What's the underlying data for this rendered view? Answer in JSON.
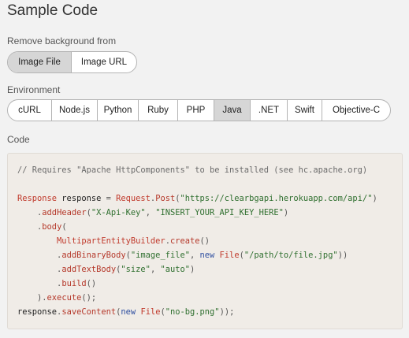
{
  "header": {
    "title": "Sample Code"
  },
  "remove_bg": {
    "label": "Remove background from",
    "options": [
      {
        "label": "Image File",
        "active": true
      },
      {
        "label": "Image URL",
        "active": false
      }
    ]
  },
  "environment": {
    "label": "Environment",
    "options": [
      {
        "label": "cURL",
        "active": false
      },
      {
        "label": "Node.js",
        "active": false
      },
      {
        "label": "Python",
        "active": false
      },
      {
        "label": "Ruby",
        "active": false
      },
      {
        "label": "PHP",
        "active": false
      },
      {
        "label": "Java",
        "active": true
      },
      {
        "label": ".NET",
        "active": false
      },
      {
        "label": "Swift",
        "active": false
      },
      {
        "label": "Objective-C",
        "active": false
      }
    ]
  },
  "code": {
    "label": "Code",
    "lines": [
      [
        {
          "t": "// Requires \"Apache HttpComponents\" to be installed (see hc.apache.org)",
          "c": "comment"
        }
      ],
      [],
      [
        {
          "t": "Response",
          "c": "type"
        },
        {
          "t": " response ",
          "c": "plain"
        },
        {
          "t": "=",
          "c": "punct"
        },
        {
          "t": " Request",
          "c": "type"
        },
        {
          "t": ".",
          "c": "punct"
        },
        {
          "t": "Post",
          "c": "method"
        },
        {
          "t": "(",
          "c": "punct"
        },
        {
          "t": "\"https://clearbgapi.herokuapp.com/api/\"",
          "c": "string"
        },
        {
          "t": ")",
          "c": "punct"
        }
      ],
      [
        {
          "t": "    ",
          "c": "plain"
        },
        {
          "t": ".",
          "c": "punct"
        },
        {
          "t": "addHeader",
          "c": "method"
        },
        {
          "t": "(",
          "c": "punct"
        },
        {
          "t": "\"X-Api-Key\"",
          "c": "string"
        },
        {
          "t": ", ",
          "c": "punct"
        },
        {
          "t": "\"INSERT_YOUR_API_KEY_HERE\"",
          "c": "string"
        },
        {
          "t": ")",
          "c": "punct"
        }
      ],
      [
        {
          "t": "    ",
          "c": "plain"
        },
        {
          "t": ".",
          "c": "punct"
        },
        {
          "t": "body",
          "c": "method"
        },
        {
          "t": "(",
          "c": "punct"
        }
      ],
      [
        {
          "t": "        ",
          "c": "plain"
        },
        {
          "t": "MultipartEntityBuilder",
          "c": "type"
        },
        {
          "t": ".",
          "c": "punct"
        },
        {
          "t": "create",
          "c": "method"
        },
        {
          "t": "()",
          "c": "punct"
        }
      ],
      [
        {
          "t": "        ",
          "c": "plain"
        },
        {
          "t": ".",
          "c": "punct"
        },
        {
          "t": "addBinaryBody",
          "c": "method"
        },
        {
          "t": "(",
          "c": "punct"
        },
        {
          "t": "\"image_file\"",
          "c": "string"
        },
        {
          "t": ", ",
          "c": "punct"
        },
        {
          "t": "new",
          "c": "kw"
        },
        {
          "t": " ",
          "c": "plain"
        },
        {
          "t": "File",
          "c": "type"
        },
        {
          "t": "(",
          "c": "punct"
        },
        {
          "t": "\"/path/to/file.jpg\"",
          "c": "string"
        },
        {
          "t": "))",
          "c": "punct"
        }
      ],
      [
        {
          "t": "        ",
          "c": "plain"
        },
        {
          "t": ".",
          "c": "punct"
        },
        {
          "t": "addTextBody",
          "c": "method"
        },
        {
          "t": "(",
          "c": "punct"
        },
        {
          "t": "\"size\"",
          "c": "string"
        },
        {
          "t": ", ",
          "c": "punct"
        },
        {
          "t": "\"auto\"",
          "c": "string"
        },
        {
          "t": ")",
          "c": "punct"
        }
      ],
      [
        {
          "t": "        ",
          "c": "plain"
        },
        {
          "t": ".",
          "c": "punct"
        },
        {
          "t": "build",
          "c": "method"
        },
        {
          "t": "()",
          "c": "punct"
        }
      ],
      [
        {
          "t": "    ",
          "c": "plain"
        },
        {
          "t": ").",
          "c": "punct"
        },
        {
          "t": "execute",
          "c": "method"
        },
        {
          "t": "();",
          "c": "punct"
        }
      ],
      [
        {
          "t": "response",
          "c": "plain"
        },
        {
          "t": ".",
          "c": "punct"
        },
        {
          "t": "saveContent",
          "c": "method"
        },
        {
          "t": "(",
          "c": "punct"
        },
        {
          "t": "new",
          "c": "kw"
        },
        {
          "t": " ",
          "c": "plain"
        },
        {
          "t": "File",
          "c": "type"
        },
        {
          "t": "(",
          "c": "punct"
        },
        {
          "t": "\"no-bg.png\"",
          "c": "string"
        },
        {
          "t": "));",
          "c": "punct"
        }
      ]
    ]
  }
}
